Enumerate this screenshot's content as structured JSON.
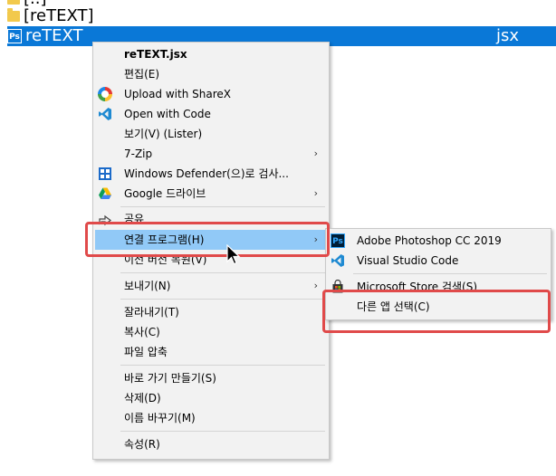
{
  "file_list": {
    "parent_row": "[..]",
    "folder_row": "[reTEXT]",
    "selected_row": {
      "name": "reTEXT",
      "ext": "jsx",
      "icon": "photoshop-icon"
    }
  },
  "context_menu": {
    "items": [
      {
        "label": "reTEXT.jsx",
        "bold": true
      },
      {
        "label": "편집(E)"
      },
      {
        "label": "Upload with ShareX",
        "icon": "sharex-icon"
      },
      {
        "label": "Open with Code",
        "icon": "vscode-icon"
      },
      {
        "label": "보기(V) (Lister)"
      },
      {
        "label": "7-Zip",
        "submenu": true
      },
      {
        "label": "Windows Defender(으)로 검사...",
        "icon": "windows-defender-icon"
      },
      {
        "label": "Google 드라이브",
        "icon": "google-drive-icon",
        "submenu": true
      },
      {
        "label": "공유",
        "icon": "share-icon"
      },
      {
        "label": "연결 프로그램(H)",
        "submenu": true,
        "hover": true
      },
      {
        "label": "이전 버전 복원(V)"
      },
      {
        "label": "보내기(N)",
        "submenu": true
      },
      {
        "label": "잘라내기(T)"
      },
      {
        "label": "복사(C)"
      },
      {
        "label": "파일 압축"
      },
      {
        "label": "바로 가기 만들기(S)"
      },
      {
        "label": "삭제(D)"
      },
      {
        "label": "이름 바꾸기(M)"
      },
      {
        "label": "속성(R)"
      }
    ],
    "submenu_arrow": "›"
  },
  "open_with_submenu": {
    "items": [
      {
        "label": "Adobe Photoshop CC 2019",
        "icon": "photoshop-icon"
      },
      {
        "label": "Visual Studio Code",
        "icon": "vscode-icon"
      },
      {
        "label": "Microsoft Store 검색(S)",
        "icon": "store-icon"
      },
      {
        "label": "다른 앱 선택(C)"
      }
    ]
  },
  "icon_text": {
    "photoshop": "Ps"
  },
  "colors": {
    "selection": "#0a78d7",
    "menu_bg": "#f2f2f2",
    "hover": "#91c9f7",
    "annotation": "#e04a4a"
  }
}
